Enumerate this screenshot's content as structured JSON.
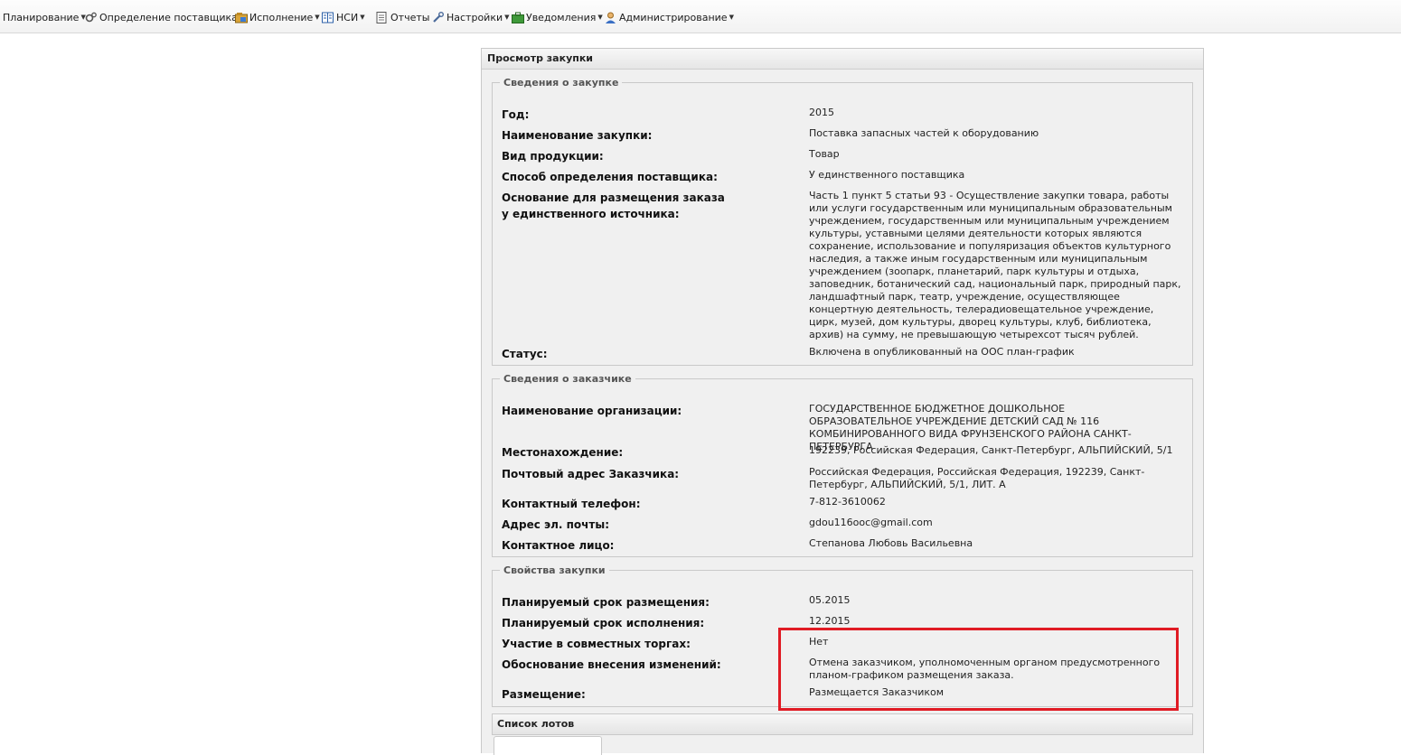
{
  "menu": {
    "items": [
      {
        "label": "Планирование",
        "icon": "none"
      },
      {
        "label": "Определение поставщика",
        "icon": "gears-icon"
      },
      {
        "label": "Исполнение",
        "icon": "folder-icon"
      },
      {
        "label": "НСИ",
        "icon": "book-icon"
      },
      {
        "label": "Отчеты",
        "icon": "document-icon"
      },
      {
        "label": "Настройки",
        "icon": "wrench-icon"
      },
      {
        "label": "Уведомления",
        "icon": "briefcase-icon"
      },
      {
        "label": "Администрирование",
        "icon": "user-icon"
      }
    ]
  },
  "panel": {
    "title": "Просмотр закупки"
  },
  "purchase": {
    "legend": "Сведения о закупке",
    "year_label": "Год:",
    "year_value": "2015",
    "name_label": "Наименование закупки:",
    "name_value": "Поставка запасных частей к оборудованию",
    "type_label": "Вид продукции:",
    "type_value": "Товар",
    "method_label": "Способ определения поставщика:",
    "method_value": "У единственного поставщика",
    "basis_label": "Основание для размещения заказа у единственного источника:",
    "basis_value": "Часть 1 пункт 5 статьи 93 - Осуществление закупки товара, работы или услуги государственным или муниципальным образовательным учреждением, государственным или муниципальным учреждением культуры, уставными целями деятельности которых являются сохранение, использование и популяризация объектов культурного наследия, а также иным государственным или муниципальным учреждением (зоопарк, планетарий, парк культуры и отдыха, заповедник, ботанический сад, национальный парк, природный парк, ландшафтный парк, театр, учреждение, осуществляющее концертную деятельность, телерадиовещательное учреждение, цирк, музей, дом культуры, дворец культуры, клуб, библиотека, архив) на сумму, не превышающую четырехсот тысяч рублей.",
    "status_label": "Статус:",
    "status_value": "Включена в опубликованный на ООС план-график"
  },
  "customer": {
    "legend": "Сведения о заказчике",
    "org_label": "Наименование организации:",
    "org_value": "ГОСУДАРСТВЕННОЕ БЮДЖЕТНОЕ ДОШКОЛЬНОЕ ОБРАЗОВАТЕЛЬНОЕ УЧРЕЖДЕНИЕ ДЕТСКИЙ САД № 116 КОМБИНИРОВАННОГО ВИДА ФРУНЗЕНСКОГО РАЙОНА САНКТ-ПЕТЕРБУРГА",
    "location_label": "Местонахождение:",
    "location_value": "192239, Российская Федерация, Санкт-Петербург, АЛЬПИЙСКИЙ, 5/1",
    "postal_label": "Почтовый адрес Заказчика:",
    "postal_value": "Российская Федерация, Российская Федерация, 192239, Санкт-Петербург, АЛЬПИЙСКИЙ, 5/1, ЛИТ. А",
    "phone_label": "Контактный телефон:",
    "phone_value": "7-812-3610062",
    "email_label": "Адрес эл. почты:",
    "email_value": "gdou116ooc@gmail.com",
    "contact_label": "Контактное лицо:",
    "contact_value": "Степанова Любовь Васильевна"
  },
  "properties": {
    "legend": "Свойства закупки",
    "placement_term_label": "Планируемый срок размещения:",
    "placement_term_value": "05.2015",
    "execution_term_label": "Планируемый срок исполнения:",
    "execution_term_value": "12.2015",
    "joint_label": "Участие в совместных торгах:",
    "joint_value": "Нет",
    "change_reason_label": "Обоснование внесения изменений:",
    "change_reason_value": "Отмена заказчиком, уполномоченным органом предусмотренного планом-графиком размещения заказа.",
    "placement_label": "Размещение:",
    "placement_value": "Размещается Заказчиком"
  },
  "lots": {
    "title": "Список лотов"
  },
  "colors": {
    "highlight": "#e01b24",
    "panel_bg": "#f0f0f0"
  }
}
